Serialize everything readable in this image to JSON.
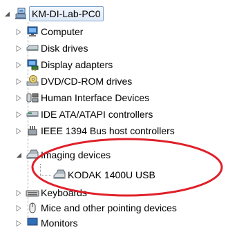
{
  "tree": {
    "root": {
      "label": "KM-DI-Lab-PC0",
      "expander": "expanded-triangle-icon",
      "icon": "computer-network-icon"
    },
    "nodes": [
      {
        "label": "Computer",
        "icon": "computer-monitor-icon",
        "expander": "collapsed-triangle-icon"
      },
      {
        "label": "Disk drives",
        "icon": "disk-drive-icon",
        "expander": "collapsed-triangle-icon"
      },
      {
        "label": "Display adapters",
        "icon": "display-adapter-icon",
        "expander": "collapsed-triangle-icon"
      },
      {
        "label": "DVD/CD-ROM drives",
        "icon": "optical-drive-icon",
        "expander": "collapsed-triangle-icon"
      },
      {
        "label": "Human Interface Devices",
        "icon": "hid-icon",
        "expander": "collapsed-triangle-icon"
      },
      {
        "label": "IDE ATA/ATAPI controllers",
        "icon": "ide-controller-icon",
        "expander": "collapsed-triangle-icon"
      },
      {
        "label": "IEEE 1394 Bus host controllers",
        "icon": "firewire-icon",
        "expander": "collapsed-triangle-icon"
      },
      {
        "label": "Imaging devices",
        "icon": "scanner-icon",
        "expander": "expanded-triangle-icon",
        "children": [
          {
            "label": "KODAK 1400U USB",
            "icon": "scanner-icon"
          }
        ]
      },
      {
        "label": "Keyboards",
        "icon": "keyboard-icon",
        "expander": "collapsed-triangle-icon"
      },
      {
        "label": "Mice and other pointing devices",
        "icon": "mouse-icon",
        "expander": "collapsed-triangle-icon"
      },
      {
        "label": "Monitors",
        "icon": "monitor-icon",
        "expander": "collapsed-triangle-icon"
      }
    ]
  },
  "annotation": {
    "shape": "ellipse",
    "color": "#e0202a"
  }
}
